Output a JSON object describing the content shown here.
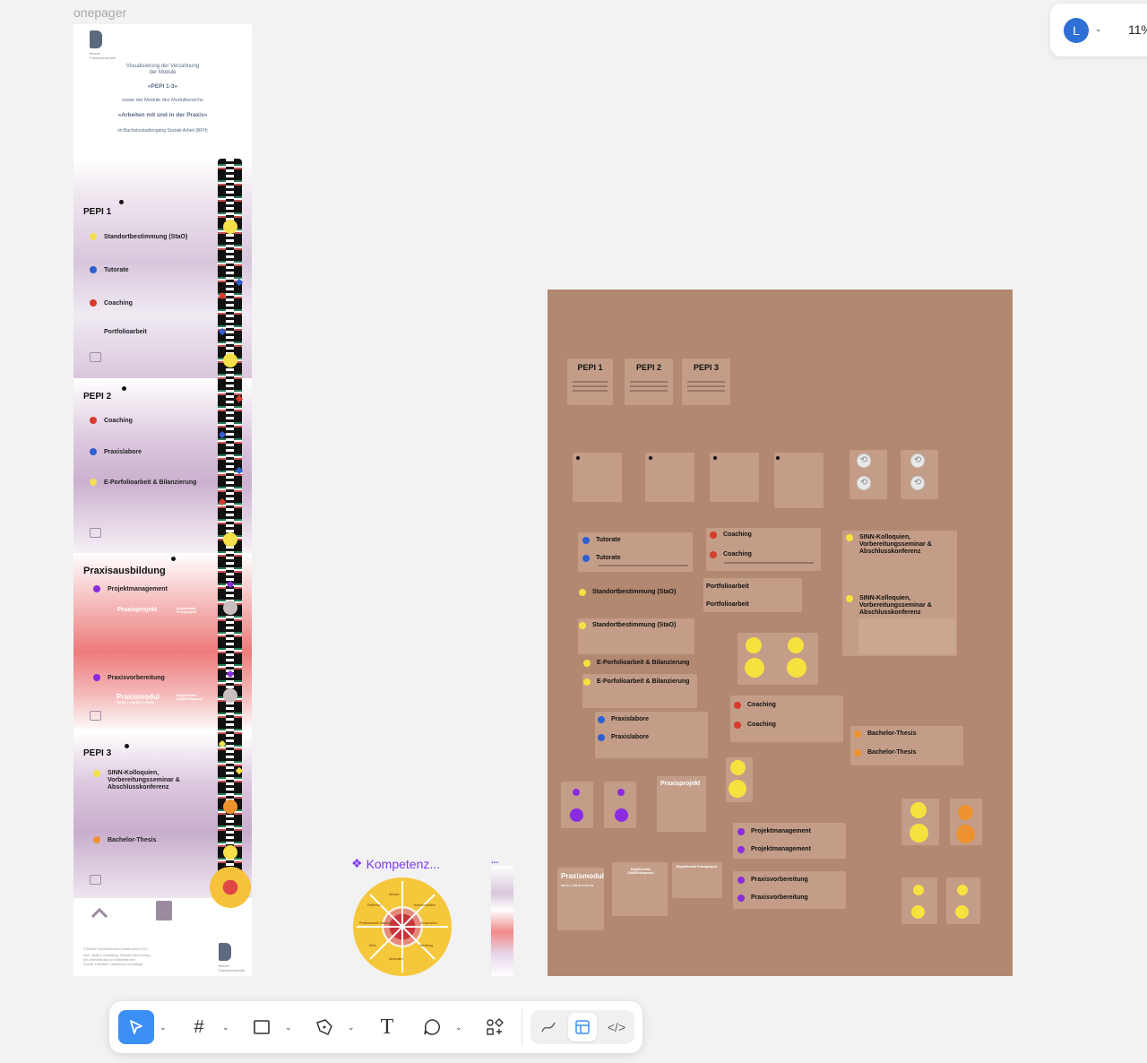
{
  "canvas": {
    "frame_label": "onepager"
  },
  "onepager": {
    "header": {
      "line1": "Visualisierung der Verzahnung",
      "line2": "der Module",
      "pepi": "«PEPI 1-3»",
      "line3": "sowie der Module des Modulbereichs",
      "praxis": "«Arbeiten mit und in der Praxis»",
      "line4": "im Bachelorstudiengang Soziale Arbeit (BFH)"
    },
    "logo_text": "Berner Fachhochschule",
    "sections": {
      "pepi1": {
        "title": "PEPI 1",
        "items": [
          "Standortbestimmung (StaO)",
          "Tutorate",
          "Coaching",
          "Portfolioarbeit"
        ]
      },
      "pepi2": {
        "title": "PEPI 2",
        "items": [
          "Coaching",
          "Praxislabore",
          "E-Porfolioarbeit & Bilanzierung"
        ]
      },
      "praxis": {
        "title": "Praxisausbildung",
        "items": [
          "Projektmanagement",
          "Praxisprojekt",
          "Begleitmodul Praxisprojekt",
          "Praxisvorbereitung",
          "Praxismodul",
          "PM 50.1 | PM 50.2 | PM 58",
          "Begleitmodul (SAM/Kolloquien)"
        ]
      },
      "pepi3": {
        "title": "PEPI 3",
        "items": [
          "SINN-Kolloquien, Vorbereitungsseminar & Abschlusskonferenz",
          "Bachelor-Thesis"
        ]
      }
    },
    "footer": {
      "line1": "© Berner Fachhochschule Soziale Arbeit 2024",
      "line2": "Idee, Inhalt & Gestaltung: Stefanie Hänni (Hrsg.)",
      "line3": "Mit Unterstützung von Mitarbeitenden",
      "line4": "Soziale & Mediale Gestaltung: Lea Balzger"
    }
  },
  "kompetenz": {
    "title": "Kompetenz...",
    "wheel_labels": [
      "Professionelle Haltung",
      "Kooperation",
      "Wissen",
      "Methoden",
      "Reflexion",
      "Kommunikation",
      "Ethik",
      "Handlung"
    ]
  },
  "mini_frame": {
    "label": "..."
  },
  "board": {
    "pepi_headers": [
      "PEPI 1",
      "PEPI 2",
      "PEPI 3"
    ],
    "items": {
      "tutorate1": "Tutorate",
      "tutorate2": "Tutorate",
      "coaching1": "Coaching",
      "coaching2": "Coaching",
      "sinn1": "SINN-Kolloquien, Vorbereitungsseminar & Abschlusskonferenz",
      "sinn2": "SINN-Kolloquien, Vorbereitungsseminar & Abschlusskonferenz",
      "stao1": "Standortbestimmung (StaO)",
      "stao2": "Standortbestimmung (StaO)",
      "portfolio1": "Portfolioarbeit",
      "portfolio2": "Portfolioarbeit",
      "eport1": "E-Porfolioarbeit & Bilanzierung",
      "eport2": "E-Porfolioarbeit & Bilanzierung",
      "coaching3": "Coaching",
      "coaching4": "Coaching",
      "labore1": "Praxislabore",
      "labore2": "Praxislabore",
      "bachelor1": "Bachelor-Thesis",
      "bachelor2": "Bachelor-Thesis",
      "praxisprojekt": "Praxisprojekt",
      "projmgmt1": "Projektmanagement",
      "projmgmt2": "Projektmanagement",
      "praxismodul": "Praxismodul",
      "praxismodul_sub": "PM 50.1 | PM 50.2 | PM 58",
      "begleit1": "Begleitmodul (SAM/Kolloquien)",
      "begleit2": "Begleitmodul Praxisprojekt",
      "vorb1": "Praxisvorbereitung",
      "vorb2": "Praxisvorbereitung"
    }
  },
  "toolbar": {
    "tools": [
      "select-tool",
      "frame-tool",
      "shape-tool",
      "pen-tool",
      "text-tool",
      "comment-tool",
      "components-tool"
    ],
    "modes": [
      "draw-mode",
      "design-mode",
      "dev-mode"
    ]
  },
  "user": {
    "initial": "L",
    "zoom": "11%"
  },
  "colors": {
    "board": "#b28871",
    "accent": "#3b8ff5",
    "yellow": "#f5e23f",
    "blue": "#2f5fd0",
    "red": "#d83a2e",
    "orange": "#ee922f",
    "purple": "#8a2be2"
  }
}
